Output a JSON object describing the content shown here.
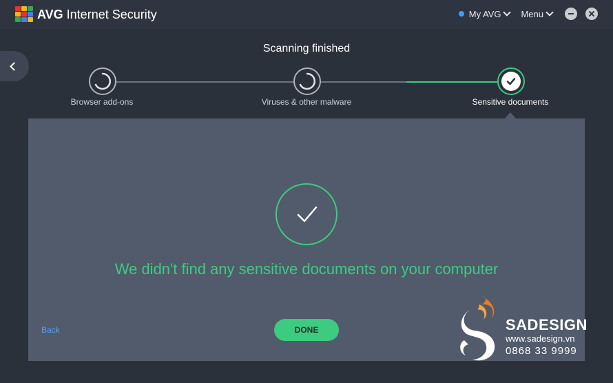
{
  "app": {
    "brand_bold": "AVG",
    "brand_rest": " Internet Security",
    "my_avg_label": "My AVG",
    "menu_label": "Menu"
  },
  "colors": {
    "accent_green": "#3dcb7f",
    "link_blue": "#4aa3ff",
    "status_dot": "#3aa0ff"
  },
  "scan": {
    "heading": "Scanning finished",
    "steps": [
      {
        "label": "Browser add-ons",
        "state": "in-progress"
      },
      {
        "label": "Viruses & other malware",
        "state": "in-progress"
      },
      {
        "label": "Sensitive documents",
        "state": "complete"
      }
    ]
  },
  "result": {
    "message": "We didn't find any sensitive documents on your computer",
    "back_label": "Back",
    "done_label": "DONE"
  },
  "watermark": {
    "title": "SADESIGN",
    "url": "www.sadesign.vn",
    "phone": "0868 33 9999"
  }
}
